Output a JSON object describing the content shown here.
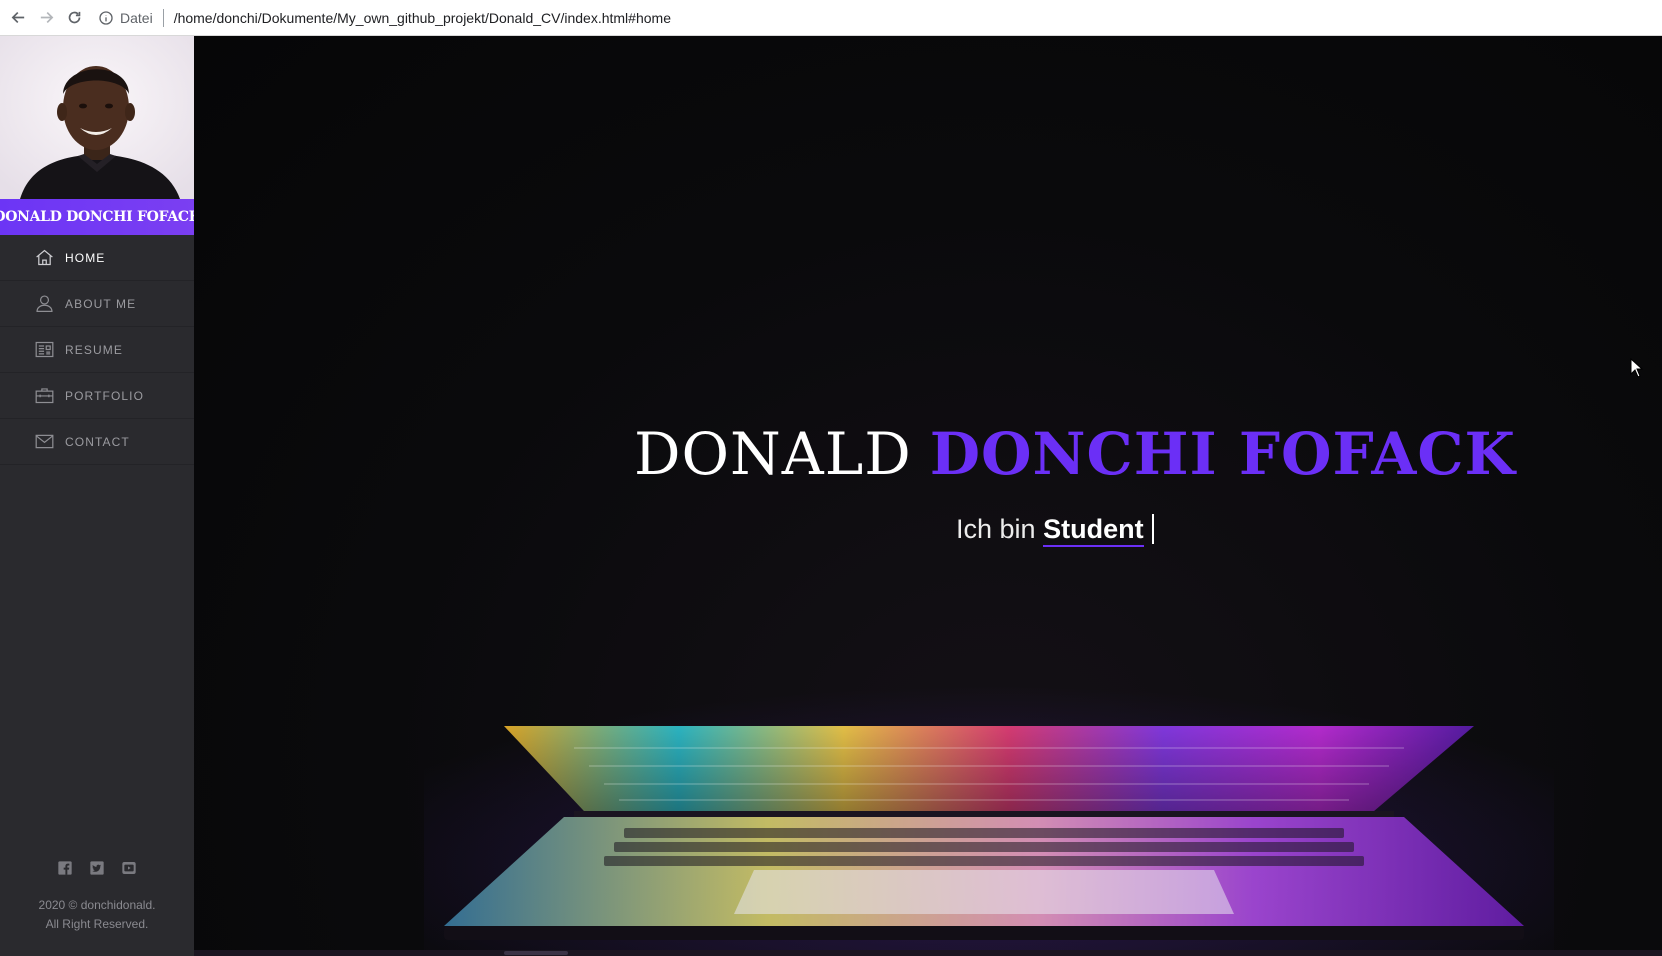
{
  "browser": {
    "scheme_label": "Datei",
    "url": "/home/donchi/Dokumente/My_own_github_projekt/Donald_CV/index.html#home"
  },
  "sidebar": {
    "name": "DONALD DONCHI FOFACK",
    "menu": [
      {
        "label": "HOME",
        "icon": "home-icon",
        "active": true
      },
      {
        "label": "ABOUT ME",
        "icon": "user-icon",
        "active": false
      },
      {
        "label": "RESUME",
        "icon": "resume-icon",
        "active": false
      },
      {
        "label": "PORTFOLIO",
        "icon": "briefcase-icon",
        "active": false
      },
      {
        "label": "CONTACT",
        "icon": "envelope-icon",
        "active": false
      }
    ],
    "social": [
      "facebook-icon",
      "twitter-icon",
      "youtube-icon"
    ],
    "footer_line1": "2020 © donchidonald.",
    "footer_line2": "All Right Reserved."
  },
  "hero": {
    "first_name": "DONALD",
    "last_name": "DONCHI FOFACK",
    "intro": "Ich bin",
    "role": "Student"
  },
  "colors": {
    "accent": "#6b2ff6",
    "sidebar_bg": "#2a2a2e",
    "hero_bg": "#0a0a0c"
  }
}
